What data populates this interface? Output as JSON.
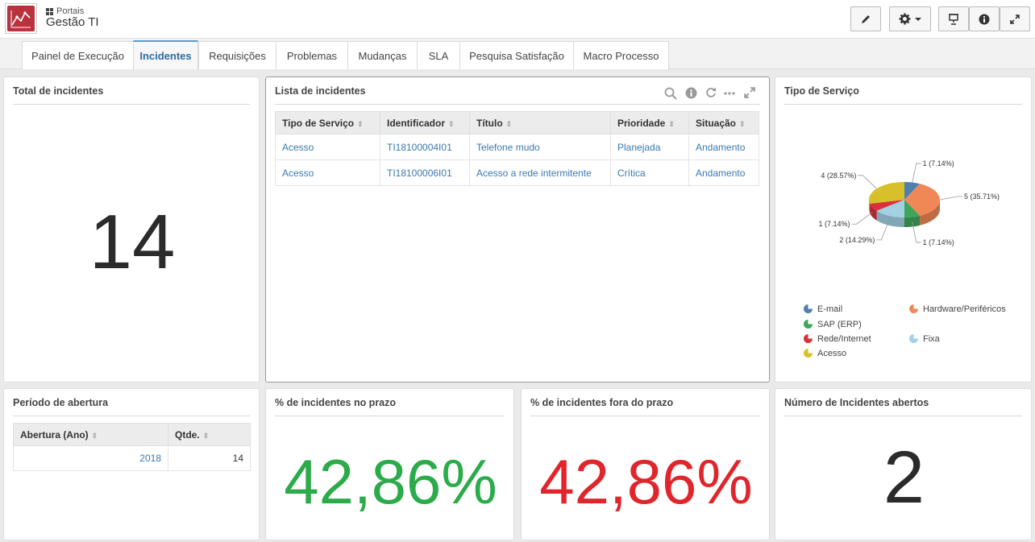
{
  "header": {
    "breadcrumb": "Portais",
    "title": "Gestão TI"
  },
  "tabs": [
    {
      "label": "Painel de Execução"
    },
    {
      "label": "Incidentes"
    },
    {
      "label": "Requisições"
    },
    {
      "label": "Problemas"
    },
    {
      "label": "Mudanças"
    },
    {
      "label": "SLA"
    },
    {
      "label": "Pesquisa Satisfação"
    },
    {
      "label": "Macro Processo"
    }
  ],
  "total_incidentes": {
    "title": "Total de incidentes",
    "value": "14"
  },
  "lista": {
    "title": "Lista de incidentes",
    "columns": [
      "Tipo de Serviço",
      "Identificador",
      "Título",
      "Prioridade",
      "Situação"
    ],
    "rows": [
      [
        "Acesso",
        "TI18100004I01",
        "Telefone mudo",
        "Planejada",
        "Andamento"
      ],
      [
        "Acesso",
        "TI18100006I01",
        "Acesso a rede intermitente",
        "Crítica",
        "Andamento"
      ]
    ]
  },
  "tipo_servico": {
    "title": "Tipo de Serviço"
  },
  "periodo": {
    "title": "Período de abertura",
    "columns": [
      "Abertura (Ano)",
      "Qtde."
    ],
    "rows": [
      [
        "2018",
        "14"
      ]
    ]
  },
  "no_prazo": {
    "title": "% de incidentes no prazo",
    "value": "42,86%",
    "color": "#2bab4a"
  },
  "fora_prazo": {
    "title": "% de incidentes fora do prazo",
    "value": "42,86%",
    "color": "#e0262c"
  },
  "abertos": {
    "title": "Número de Incidentes abertos",
    "value": "2"
  },
  "chart_data": {
    "type": "pie",
    "categories": [
      "E-mail",
      "Hardware/Periféricos",
      "SAP (ERP)",
      "Fixa",
      "Rede/Internet",
      "Acesso"
    ],
    "values": [
      1,
      5,
      1,
      2,
      1,
      4
    ],
    "data_labels": [
      "1 (7.14%)",
      "5 (35.71%)",
      "1 (7.14%)",
      "2 (14.29%)",
      "1 (7.14%)",
      "4 (28.57%)"
    ],
    "colors": [
      "#4f7fae",
      "#ef8756",
      "#3ea55a",
      "#a3d1e3",
      "#d9303a",
      "#d8c02b"
    ],
    "legend_position": "bottom"
  }
}
